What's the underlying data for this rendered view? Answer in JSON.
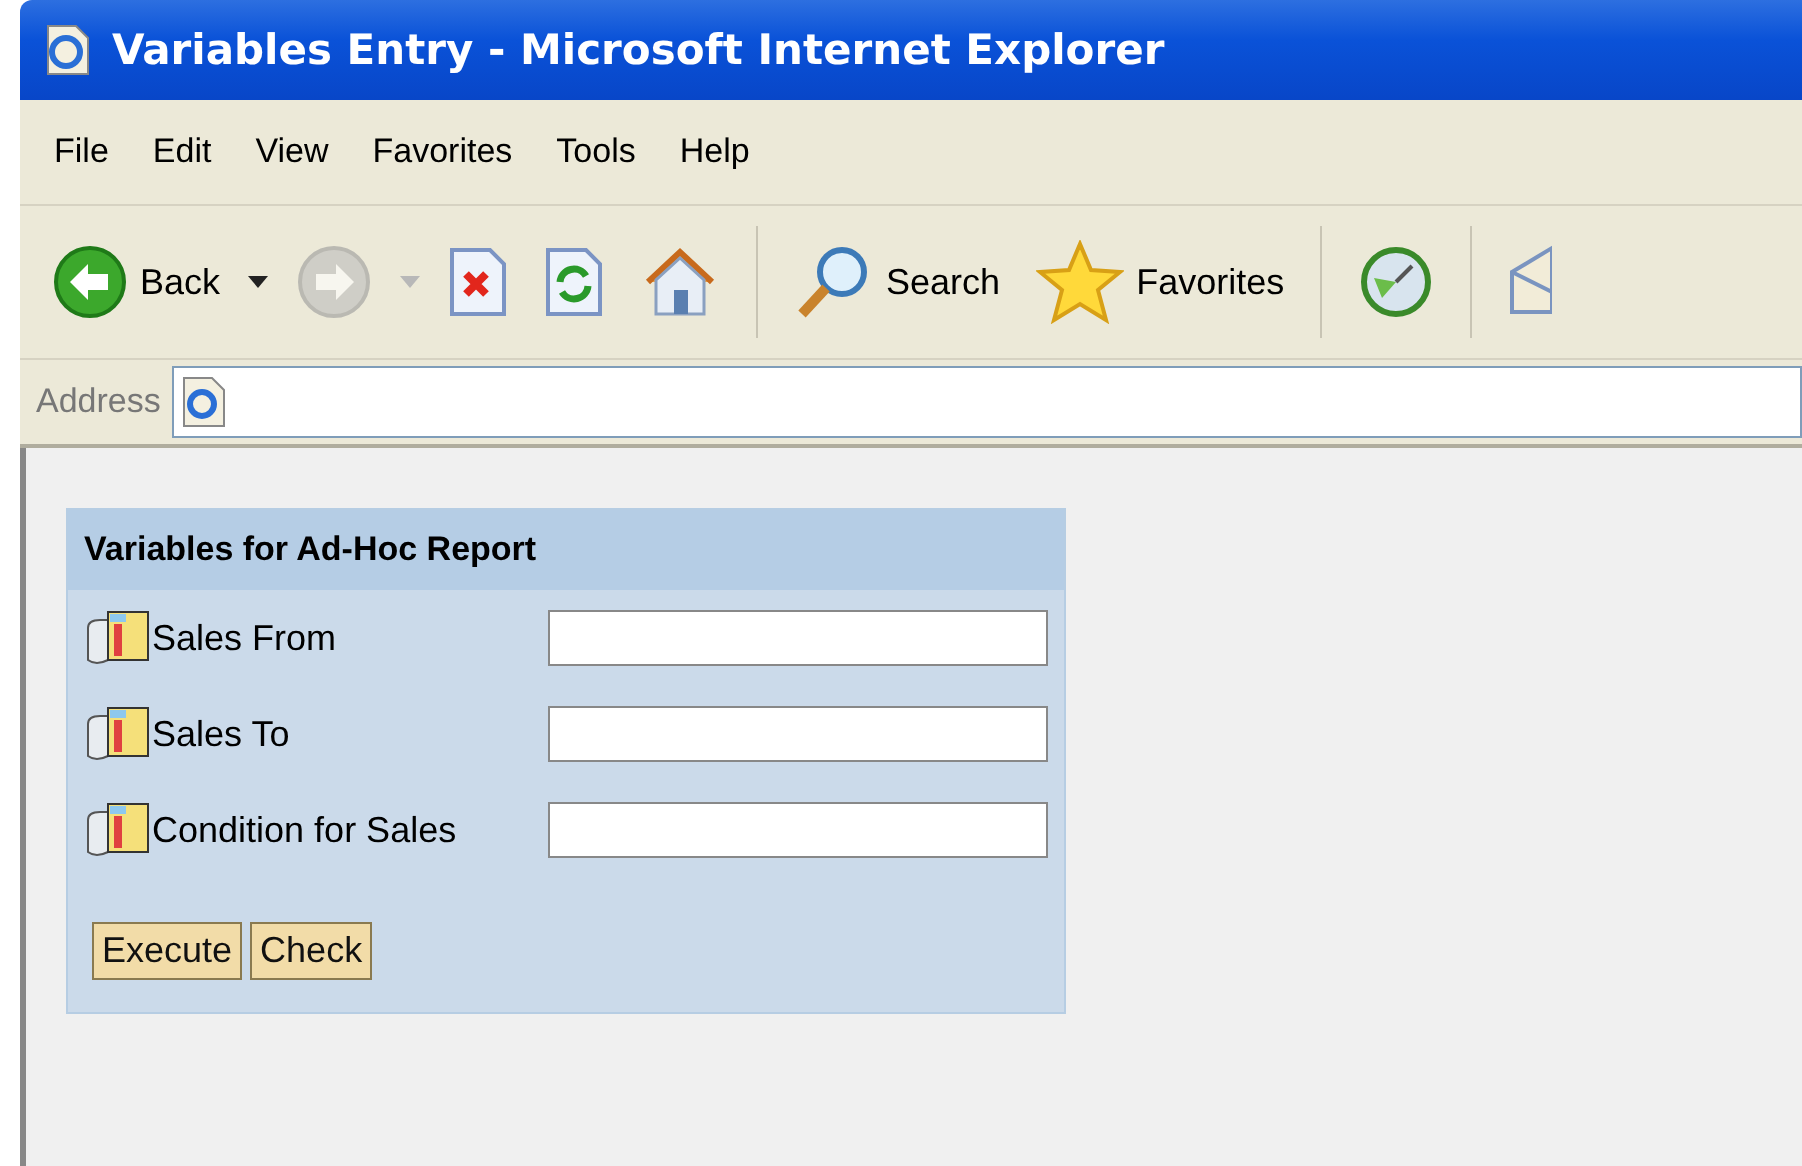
{
  "window": {
    "title": "Variables Entry - Microsoft Internet Explorer"
  },
  "menu": [
    "File",
    "Edit",
    "View",
    "Favorites",
    "Tools",
    "Help"
  ],
  "toolbar": [
    {
      "kind": "back",
      "label": "Back",
      "disabled": false
    },
    {
      "kind": "forward",
      "disabled": true
    },
    {
      "kind": "stop",
      "disabled": false
    },
    {
      "kind": "refresh",
      "disabled": false
    },
    {
      "kind": "home",
      "disabled": false
    },
    {
      "kind": "search",
      "label": "Search",
      "disabled": false
    },
    {
      "kind": "favorites",
      "label": "Favorites",
      "disabled": false
    },
    {
      "kind": "media",
      "disabled": false
    },
    {
      "kind": "mail",
      "disabled": false
    }
  ],
  "address": {
    "label": "Address"
  },
  "form": {
    "title": "Variables for Ad-Hoc Report",
    "variables": [
      {
        "label": "Sales From"
      },
      {
        "label": "Sales To"
      },
      {
        "label": "Condition for Sales"
      }
    ],
    "buttons": [
      "Execute",
      "Check"
    ]
  }
}
